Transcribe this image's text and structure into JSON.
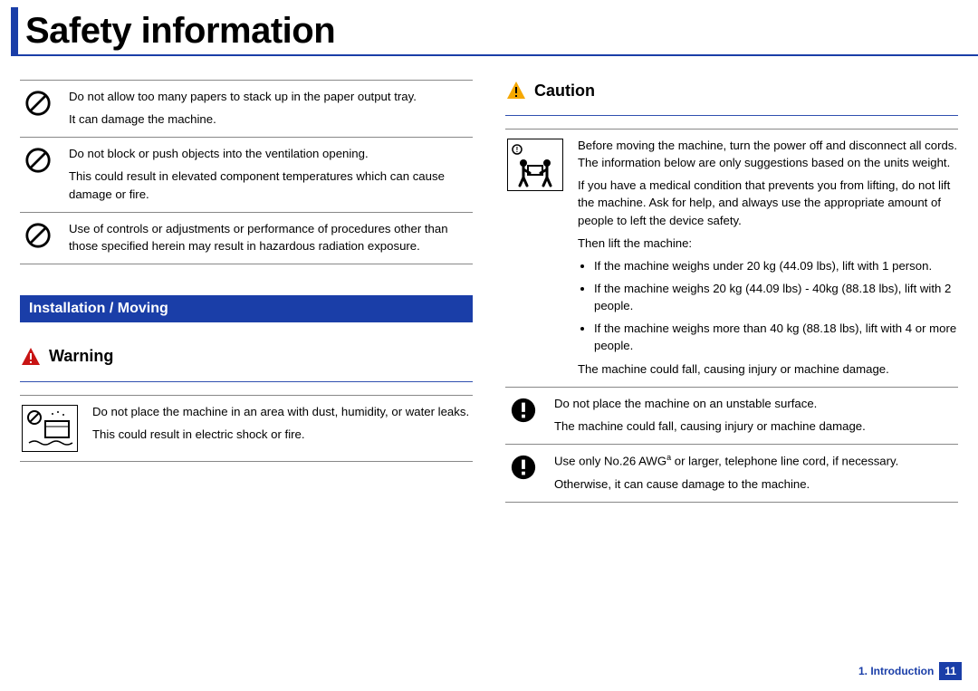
{
  "page": {
    "title": "Safety information",
    "footer_chapter": "1. Introduction",
    "page_number": "11"
  },
  "left": {
    "rows": [
      {
        "icon": "prohibit",
        "p1": "Do not allow too many papers to stack up in the paper output tray.",
        "p2": "It can damage the machine."
      },
      {
        "icon": "prohibit",
        "p1": "Do not block or push objects into the ventilation opening.",
        "p2": "This could result in elevated component temperatures which can cause damage or fire."
      },
      {
        "icon": "prohibit",
        "p1": "Use of controls or adjustments or performance of procedures other than those specified herein may result in hazardous radiation exposure."
      }
    ],
    "section_header": "Installation / Moving",
    "warning": {
      "label": "Warning",
      "row": {
        "icon": "water-hazard",
        "p1": "Do not place the machine in an area with dust, humidity, or water leaks.",
        "p2": "This could result in electric shock or fire."
      }
    }
  },
  "right": {
    "caution": {
      "label": "Caution"
    },
    "row_lift": {
      "icon": "two-person-lift",
      "p1": "Before moving the machine, turn the power off and disconnect all cords. The information below are only suggestions based on the units weight.",
      "p2": "If you have a medical condition that prevents you from lifting, do not lift the machine. Ask for help, and always use the appropriate amount of people to left the device safety.",
      "p3": "Then lift the machine:",
      "b1": "If the machine weighs under 20 kg (44.09 lbs), lift with 1 person.",
      "b2": "If the machine weighs 20 kg (44.09 lbs) - 40kg (88.18 lbs), lift with 2 people.",
      "b3": "If the machine weighs more than 40 kg (88.18 lbs), lift with 4 or more people.",
      "p4": "The machine could fall, causing injury or machine damage."
    },
    "row_surface": {
      "icon": "mandatory",
      "p1": "Do not place the machine on an unstable surface.",
      "p2": "The machine could fall, causing injury or machine damage."
    },
    "row_cord": {
      "icon": "mandatory",
      "p1_a": "Use only No.26 AWG",
      "p1_sup": "a",
      "p1_b": " or larger, telephone line cord, if necessary.",
      "p2": "Otherwise, it can cause damage to the machine."
    }
  }
}
